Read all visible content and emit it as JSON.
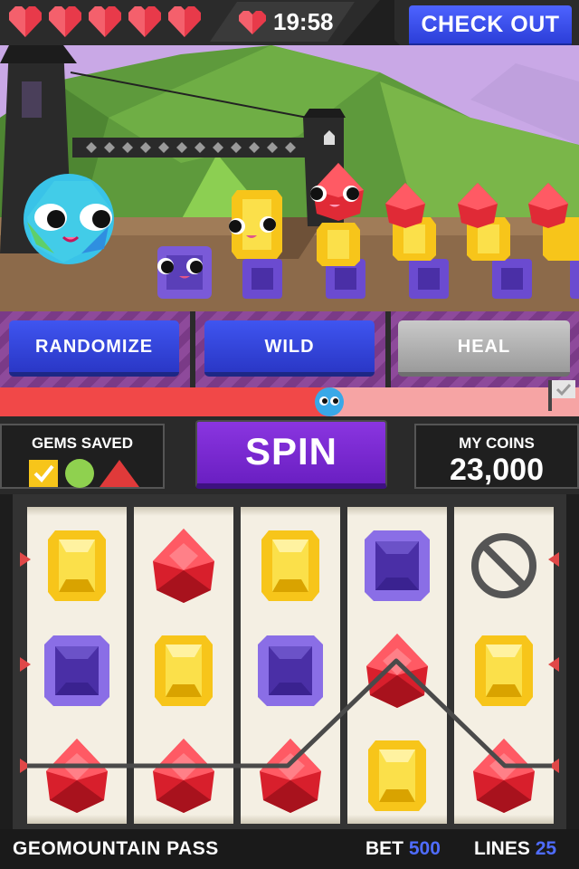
{
  "hud": {
    "lives": 5,
    "timer": "19:58",
    "checkout_label": "CHECK OUT"
  },
  "powers": [
    {
      "label": "RANDOMIZE",
      "enabled": true
    },
    {
      "label": "WILD",
      "enabled": true
    },
    {
      "label": "HEAL",
      "enabled": false
    }
  ],
  "progress": {
    "fraction": 0.57
  },
  "gems_saved": {
    "title": "GEMS SAVED",
    "icons": [
      "yellow-check-square-icon",
      "green-circle-icon",
      "red-triangle-icon"
    ]
  },
  "spin_label": "SPIN",
  "coins": {
    "title": "MY COINS",
    "value": "23,000"
  },
  "reels": [
    [
      "yellow",
      "purple",
      "red"
    ],
    [
      "red",
      "yellow",
      "red"
    ],
    [
      "yellow",
      "purple",
      "red"
    ],
    [
      "purple",
      "red",
      "yellow"
    ],
    [
      "blocked",
      "yellow",
      "red"
    ]
  ],
  "footer": {
    "level_name": "GEOMOUNTAIN PASS",
    "bet_label": "BET",
    "bet_value": "500",
    "lines_label": "LINES",
    "lines_value": "25"
  },
  "colors": {
    "accent_blue": "#3f55f0",
    "spin_purple": "#7a2ad4",
    "progress_red": "#f14848",
    "gem_yellow": "#f7c51a",
    "gem_red": "#e02a36",
    "gem_purple": "#7a5ad8"
  }
}
